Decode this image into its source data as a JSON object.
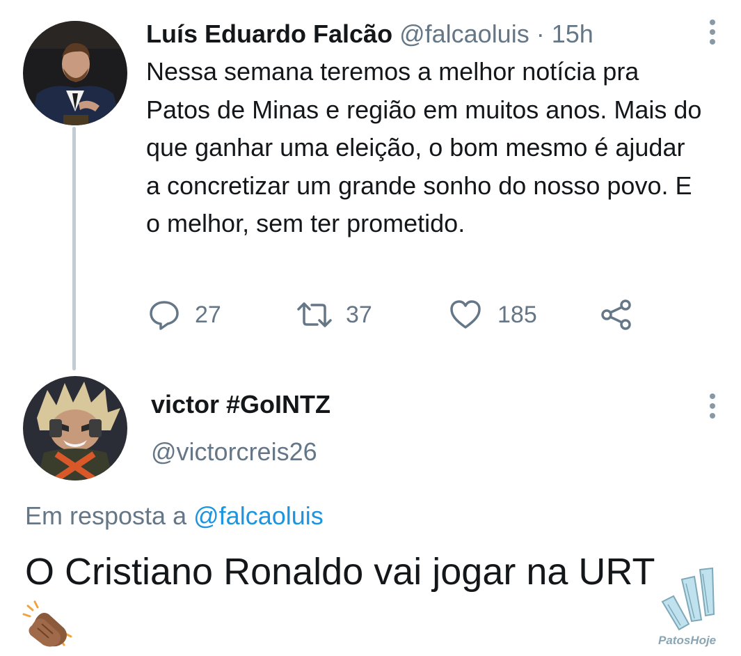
{
  "tweet": {
    "author_name": "Luís Eduardo Falcão",
    "handle": "@falcaoluis",
    "separator": "·",
    "time": "15h",
    "body": "Nessa semana teremos a melhor notícia pra Patos de Minas e região em muitos anos. Mais do que ganhar uma eleição, o bom mesmo é ajudar a concretizar um grande sonho do nosso povo. E o melhor, sem ter prometido.",
    "actions": {
      "reply": {
        "icon": "reply-icon",
        "count": "27"
      },
      "retweet": {
        "icon": "retweet-icon",
        "count": "37"
      },
      "like": {
        "icon": "like-icon",
        "count": "185"
      },
      "share": {
        "icon": "share-icon"
      }
    },
    "more_icon": "more-vertical-icon"
  },
  "reply": {
    "author_name": "victor #GoINTZ",
    "handle": "@victorcreis26",
    "in_reply_prefix": "Em resposta a",
    "in_reply_mention": "@falcaoluis",
    "text": "O Cristiano Ronaldo vai jogar na URT",
    "emoji_icon": "clapping-hands-icon",
    "more_icon": "more-vertical-icon"
  },
  "watermark": {
    "text": "PatosHoje"
  },
  "colors": {
    "text": "#14171a",
    "muted": "#657786",
    "link": "#1b95e0",
    "thread_line": "#c4ccd3"
  }
}
